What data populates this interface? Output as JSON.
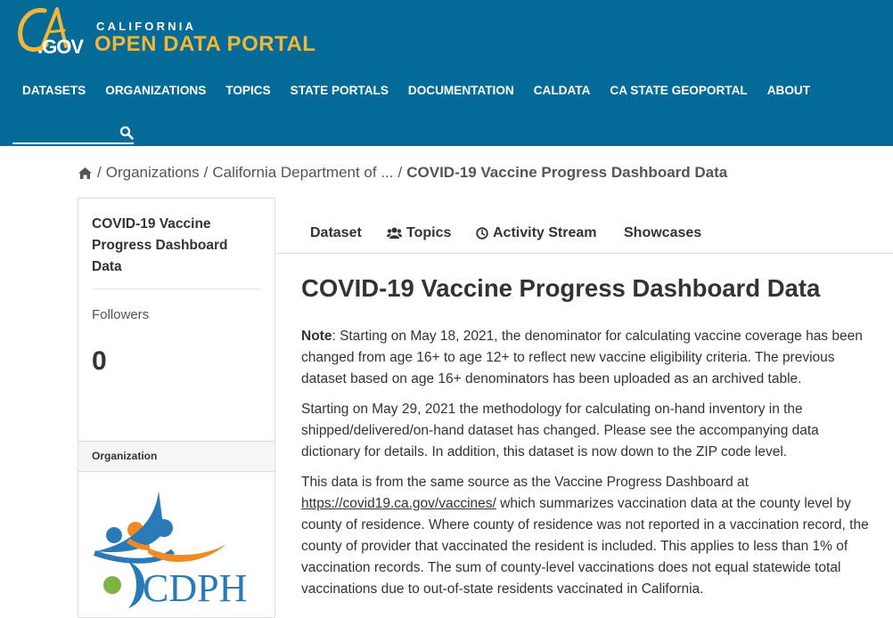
{
  "header": {
    "logo_ca": "CA",
    "logo_gov": ".GOV",
    "logo_state": "CALIFORNIA",
    "logo_portal": "OPEN DATA PORTAL",
    "colors": {
      "background": "#046b99",
      "accent": "#f3b637",
      "text": "#ffffff"
    },
    "nav": [
      "DATASETS",
      "ORGANIZATIONS",
      "TOPICS",
      "STATE PORTALS",
      "DOCUMENTATION",
      "CALDATA",
      "CA STATE GEOPORTAL",
      "ABOUT"
    ],
    "search": {
      "value": "",
      "icon": "search-icon"
    }
  },
  "breadcrumb": {
    "home_icon": "home-icon",
    "items": [
      "Organizations",
      "California Department of ...",
      "COVID-19 Vaccine Progress Dashboard Data"
    ]
  },
  "sidebar": {
    "title": "COVID-19 Vaccine Progress Dashboard Data",
    "followers_label": "Followers",
    "followers_count": "0",
    "section_label": "Organization",
    "org_logo_text": "CDPH"
  },
  "tabs": [
    {
      "label": "Dataset",
      "icon": ""
    },
    {
      "label": "Topics",
      "icon": "users-icon"
    },
    {
      "label": "Activity Stream",
      "icon": "clock-icon"
    },
    {
      "label": "Showcases",
      "icon": ""
    }
  ],
  "main": {
    "title": "COVID-19 Vaccine Progress Dashboard Data",
    "p1_bold": "Note",
    "p1_lines": [
      ": Starting on May 18, 2021, the denominator for calculating vaccine coverage has been",
      "changed from age 16+ to age 12+ to reflect new vaccine eligibility criteria. The previous",
      "dataset based on age 16+ denominators has been uploaded as an archived table."
    ],
    "p2_lines": [
      "Starting on May 29, 2021 the methodology for calculating on-hand inventory in the",
      "shipped/delivered/on-hand dataset has changed. Please see the accompanying data",
      "dictionary for details. In addition, this dataset is now down to the ZIP code level."
    ],
    "p3_line1": "This data is from the same source as the Vaccine Progress Dashboard at",
    "p3_link": "https://covid19.ca.gov/vaccines/",
    "p3_line2_rest": " which summarizes vaccination data at the county level by",
    "p3_lines": [
      "county of residence. Where county of residence was not reported in a vaccination record, the",
      "county of provider that vaccinated the resident is included. This applies to less than 1% of",
      "vaccination records. The sum of county-level vaccinations does not equal statewide total",
      "vaccinations due to out-of-state residents vaccinated in California."
    ]
  }
}
